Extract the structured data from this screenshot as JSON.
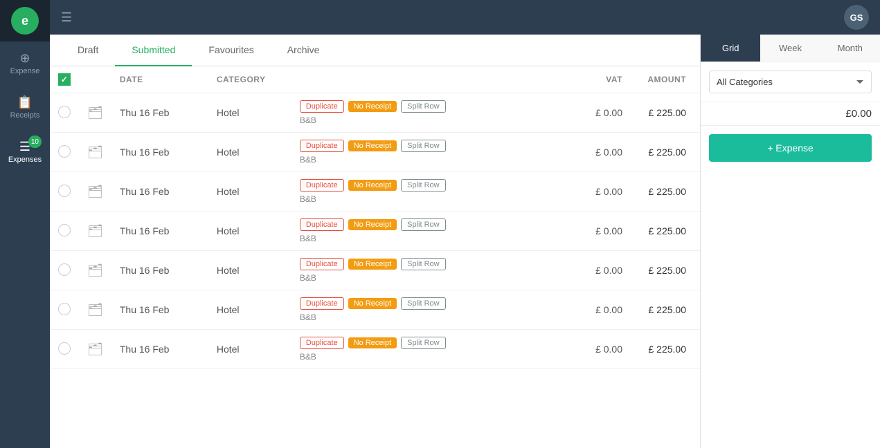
{
  "sidebar": {
    "logo_text": "e",
    "items": [
      {
        "id": "expense",
        "label": "Expense",
        "icon": "⊕"
      },
      {
        "id": "receipts",
        "label": "Receipts",
        "icon": "🧾"
      },
      {
        "id": "expenses",
        "label": "Expenses",
        "icon": "≡",
        "badge": "10",
        "active": true
      }
    ]
  },
  "topbar": {
    "menu_icon": "☰",
    "user_initials": "GS"
  },
  "tabs": [
    {
      "id": "draft",
      "label": "Draft"
    },
    {
      "id": "submitted",
      "label": "Submitted",
      "active": true
    },
    {
      "id": "favourites",
      "label": "Favourites"
    },
    {
      "id": "archive",
      "label": "Archive"
    }
  ],
  "table": {
    "columns": [
      {
        "id": "check",
        "label": ""
      },
      {
        "id": "icon",
        "label": ""
      },
      {
        "id": "date",
        "label": "DATE"
      },
      {
        "id": "category",
        "label": "CATEGORY"
      },
      {
        "id": "details",
        "label": ""
      },
      {
        "id": "vat",
        "label": "VAT"
      },
      {
        "id": "amount",
        "label": "AMOUNT"
      }
    ],
    "rows": [
      {
        "id": 1,
        "date": "Thu 16 Feb",
        "category": "Hotel",
        "sub": "B&B",
        "vat": "£ 0.00",
        "amount": "£ 225.00"
      },
      {
        "id": 2,
        "date": "Thu 16 Feb",
        "category": "Hotel",
        "sub": "B&B",
        "vat": "£ 0.00",
        "amount": "£ 225.00"
      },
      {
        "id": 3,
        "date": "Thu 16 Feb",
        "category": "Hotel",
        "sub": "B&B",
        "vat": "£ 0.00",
        "amount": "£ 225.00"
      },
      {
        "id": 4,
        "date": "Thu 16 Feb",
        "category": "Hotel",
        "sub": "B&B",
        "vat": "£ 0.00",
        "amount": "£ 225.00"
      },
      {
        "id": 5,
        "date": "Thu 16 Feb",
        "category": "Hotel",
        "sub": "B&B",
        "vat": "£ 0.00",
        "amount": "£ 225.00"
      },
      {
        "id": 6,
        "date": "Thu 16 Feb",
        "category": "Hotel",
        "sub": "B&B",
        "vat": "£ 0.00",
        "amount": "£ 225.00"
      },
      {
        "id": 7,
        "date": "Thu 16 Feb",
        "category": "Hotel",
        "sub": "B&B",
        "vat": "£ 0.00",
        "amount": "£ 225.00"
      }
    ],
    "tags": {
      "duplicate": "Duplicate",
      "no_receipt": "No Receipt",
      "split_row": "Split Row"
    }
  },
  "right_panel": {
    "view_tabs": [
      {
        "id": "grid",
        "label": "Grid",
        "active": true
      },
      {
        "id": "week",
        "label": "Week"
      },
      {
        "id": "month",
        "label": "Month"
      }
    ],
    "category_filter": "All Categories",
    "total_amount": "£0.00",
    "add_button_label": "+ Expense"
  }
}
